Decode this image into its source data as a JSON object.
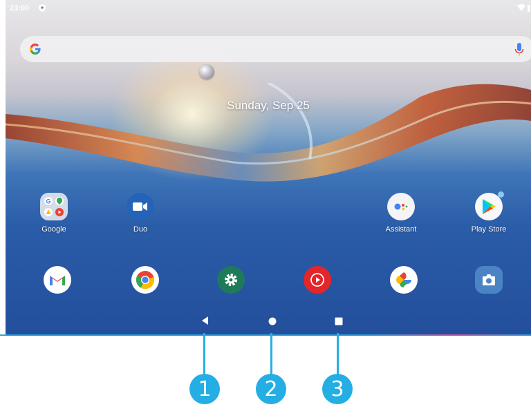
{
  "status_bar": {
    "time": "23:00",
    "left_icon": "shield-icon",
    "right_icons": [
      "wifi-icon",
      "battery-icon"
    ]
  },
  "search_bar": {
    "left_icon": "google-g-icon",
    "right_icon": "mic-icon"
  },
  "date_widget": {
    "text": "Sunday, Sep 25"
  },
  "apps_row1": [
    {
      "label": "Google",
      "icon": "google-folder-icon"
    },
    {
      "label": "Duo",
      "icon": "duo-icon"
    },
    {
      "label": "Assistant",
      "icon": "assistant-icon"
    },
    {
      "label": "Play Store",
      "icon": "play-store-icon"
    }
  ],
  "dock": [
    {
      "icon": "gmail-icon"
    },
    {
      "icon": "chrome-icon"
    },
    {
      "icon": "settings-icon"
    },
    {
      "icon": "youtube-music-icon"
    },
    {
      "icon": "photos-icon"
    },
    {
      "icon": "camera-icon"
    }
  ],
  "nav_bar": {
    "back": "back-icon",
    "home": "home-icon",
    "recents": "recents-icon"
  },
  "callouts": [
    "1",
    "2",
    "3"
  ],
  "colors": {
    "callout": "#25aee3",
    "wallpaper_top": "#e8e7ea",
    "wallpaper_bottom": "#234f9c"
  }
}
